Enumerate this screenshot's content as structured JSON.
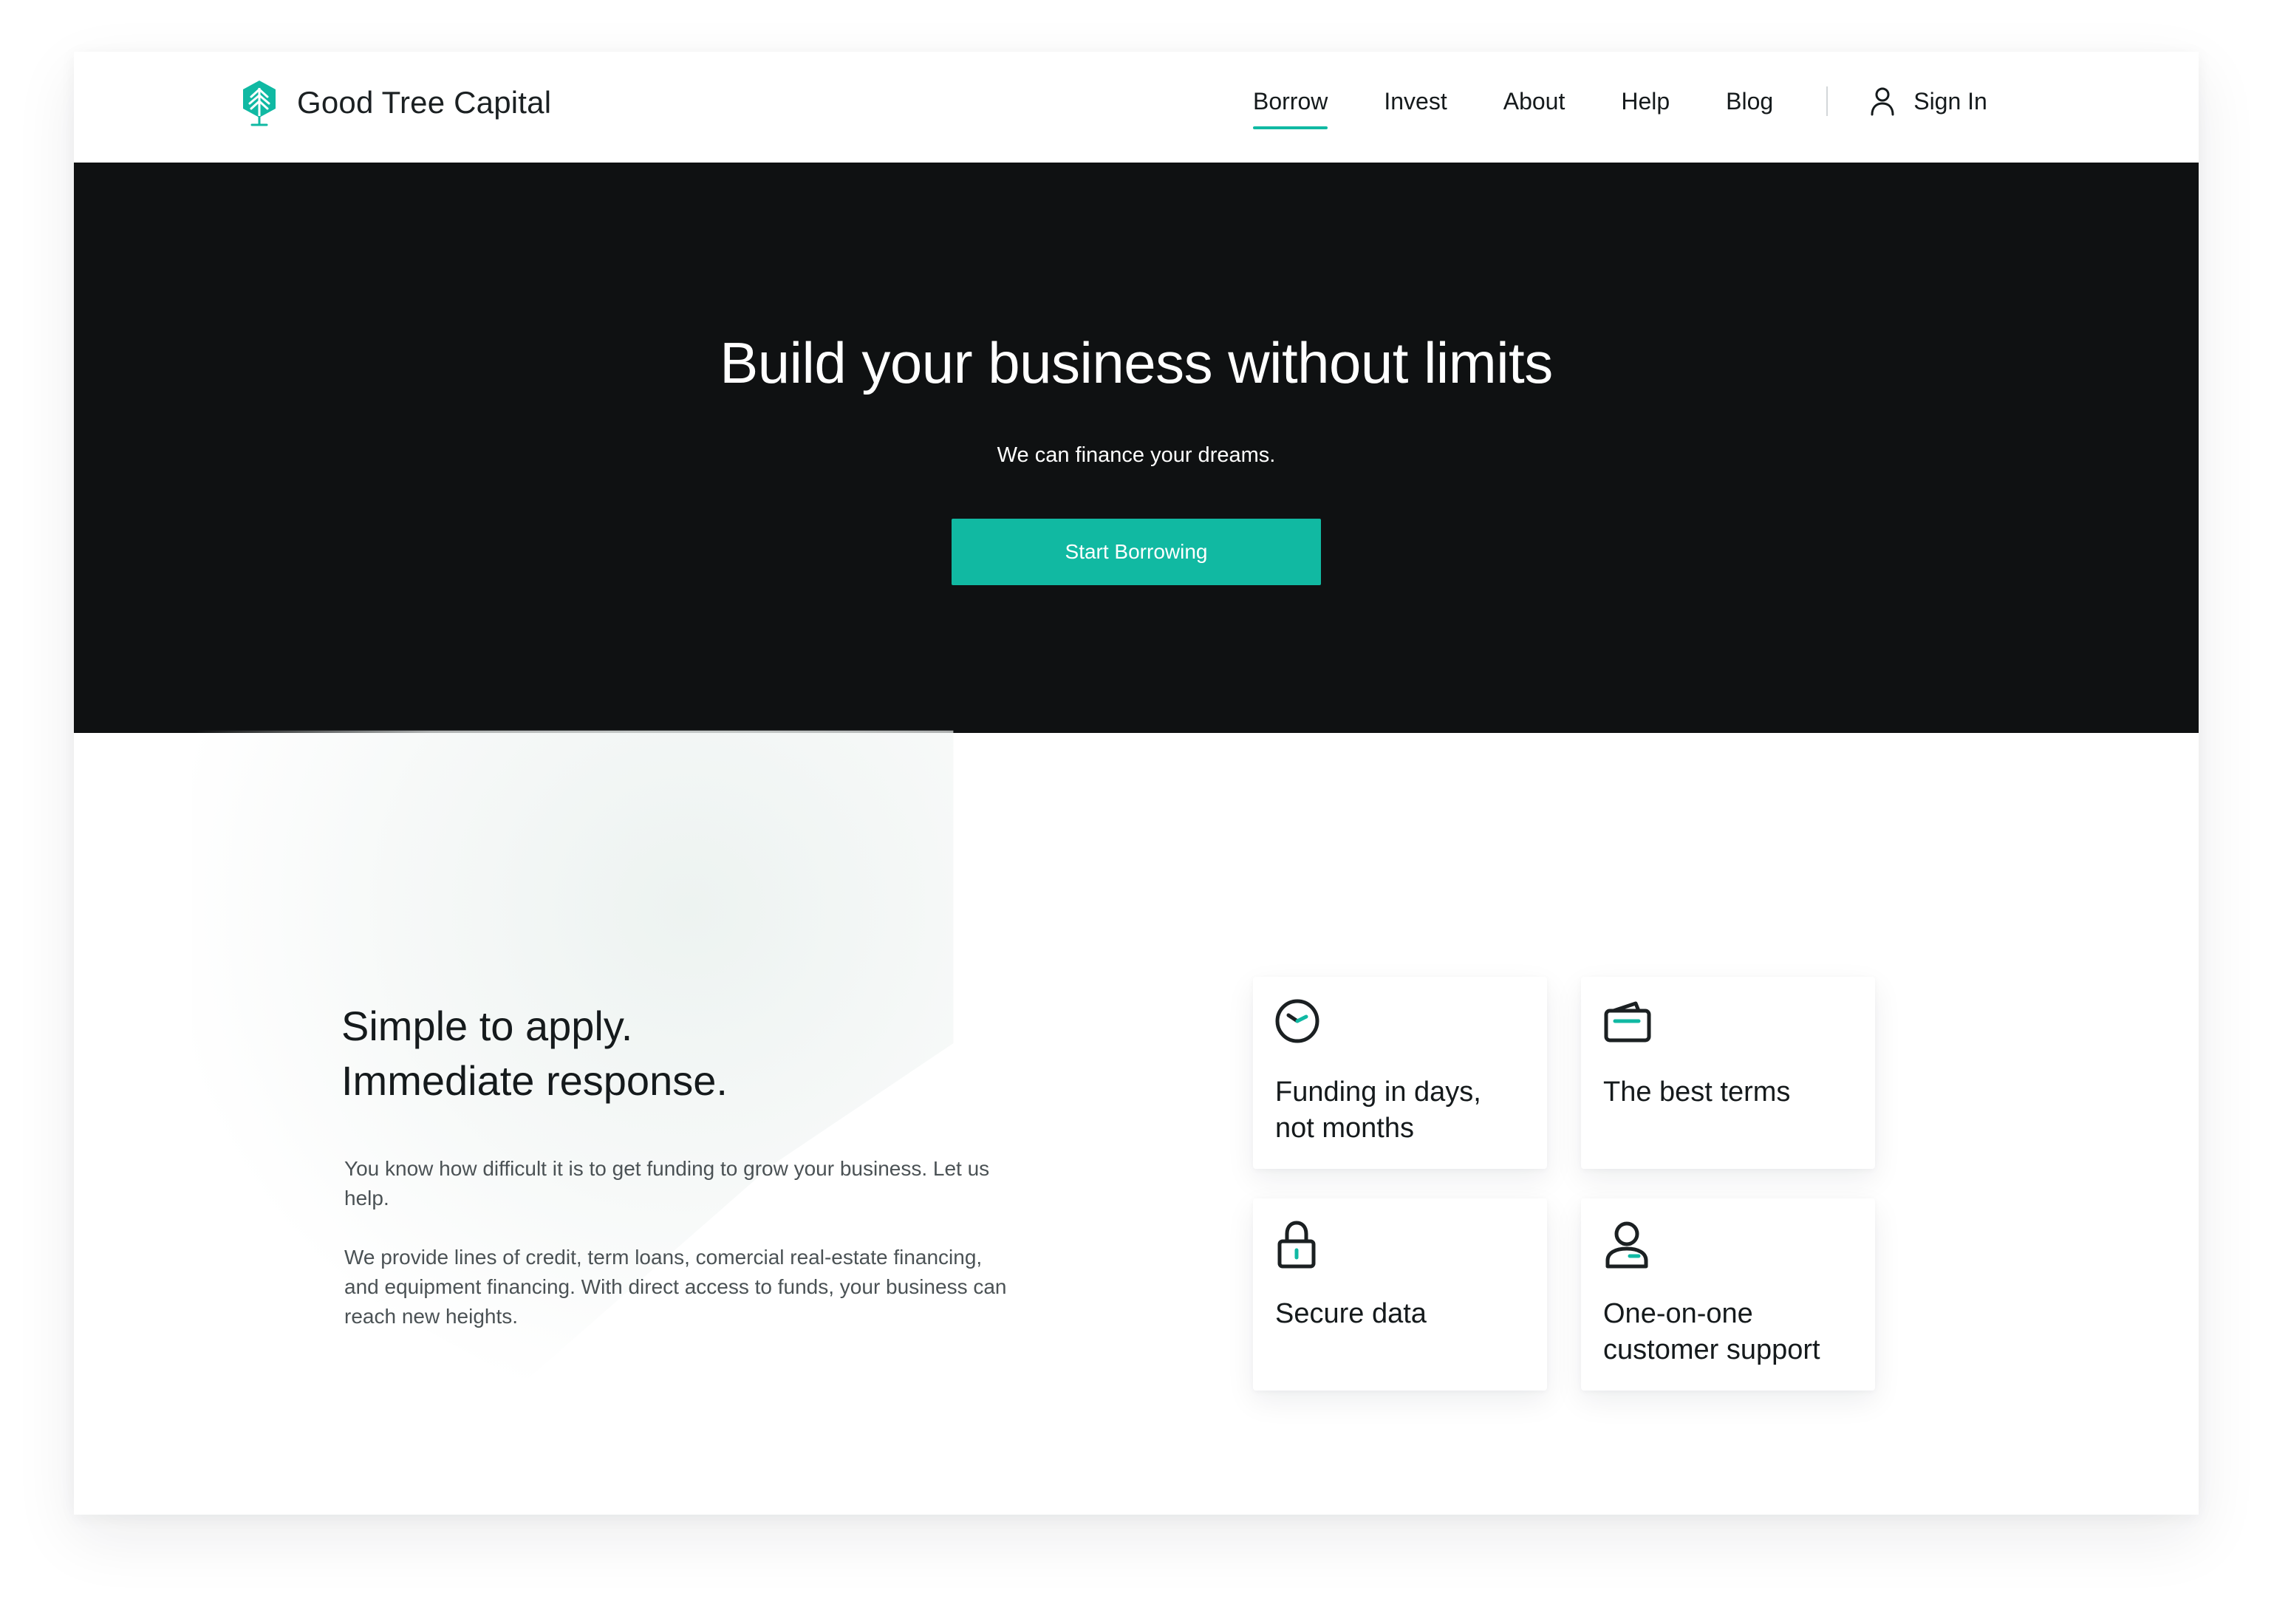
{
  "brand": {
    "name": "Good Tree Capital",
    "logo_icon": "tree-hexagon-logo",
    "accent_color": "#10b9a3"
  },
  "nav": {
    "items": [
      {
        "label": "Borrow",
        "active": true
      },
      {
        "label": "Invest",
        "active": false
      },
      {
        "label": "About",
        "active": false
      },
      {
        "label": "Help",
        "active": false
      },
      {
        "label": "Blog",
        "active": false
      }
    ],
    "sign_in": {
      "label": "Sign In",
      "icon": "user-icon"
    }
  },
  "hero": {
    "title": "Build your business without limits",
    "subtitle": "We can finance your dreams.",
    "cta": "Start Borrowing",
    "background_color": "#0f1112",
    "cta_color": "#11b9a2"
  },
  "features": {
    "heading": {
      "line1": "Simple to apply.",
      "line2": "Immediate response."
    },
    "paragraphs": [
      "You know how difficult it is to get funding to grow your business. Let us help.",
      "We provide lines of credit, term loans, comercial real-estate financing, and equipment financing. With direct access to funds, your business can reach new heights."
    ],
    "cards": [
      {
        "icon": "clock-icon",
        "line1": "Funding in days,",
        "line2": "not months"
      },
      {
        "icon": "wallet-icon",
        "line1": "The best terms",
        "line2": ""
      },
      {
        "icon": "lock-icon",
        "line1": "Secure data",
        "line2": ""
      },
      {
        "icon": "user-support-icon",
        "line1": "One-on-one",
        "line2": "customer support"
      }
    ]
  }
}
